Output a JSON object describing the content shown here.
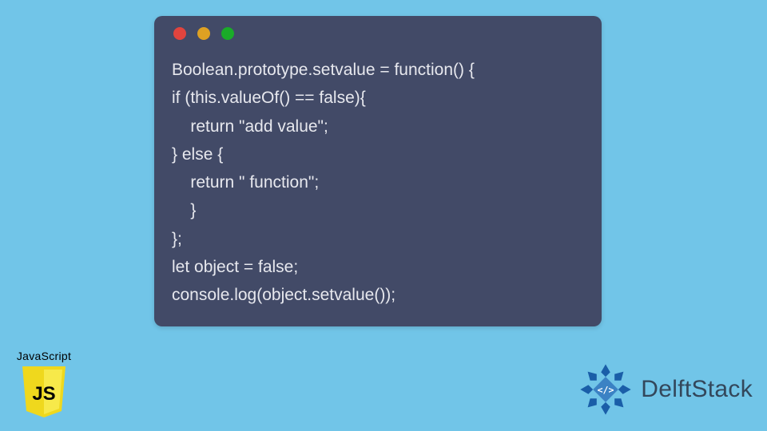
{
  "window": {
    "colors": {
      "red": "#e0443e",
      "yellow": "#dea123",
      "green": "#1aab29"
    }
  },
  "code": {
    "lines": [
      "Boolean.prototype.setvalue = function() {",
      "if (this.valueOf() == false){",
      "    return \"add value\";",
      "} else {",
      "    return \" function\";",
      "    }",
      "};",
      "let object = false;",
      "console.log(object.setvalue());"
    ]
  },
  "js_badge": {
    "label": "JavaScript",
    "letters": "JS"
  },
  "brand": {
    "name": "DelftStack"
  }
}
